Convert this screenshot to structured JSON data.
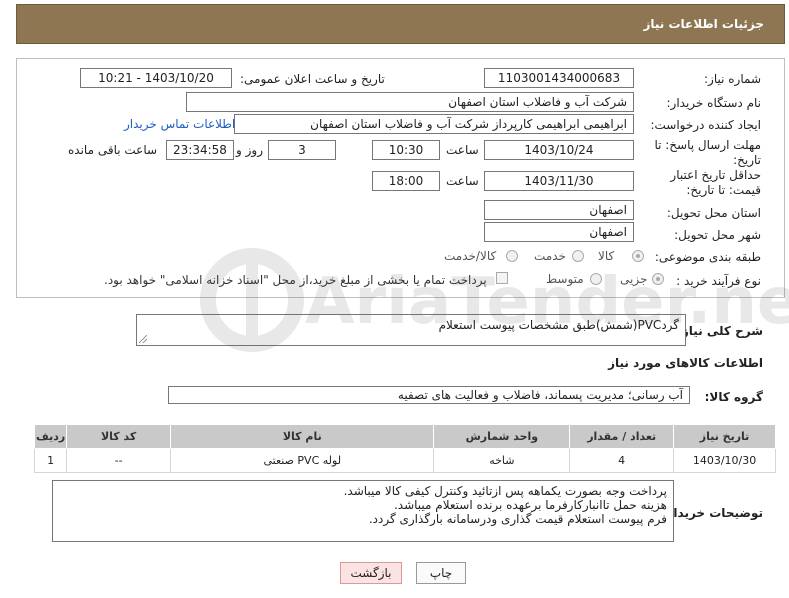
{
  "header": {
    "title": "جزئیات اطلاعات نیاز"
  },
  "form": {
    "need_number_label": "شماره نیاز:",
    "need_number": "1103001434000683",
    "announce_label": "تاریخ و ساعت اعلان عمومی:",
    "announce_value": "1403/10/20 - 10:21",
    "buyer_org_label": "نام دستگاه خریدار:",
    "buyer_org": "شرکت آب و فاضلاب استان اصفهان",
    "creator_label": "ایجاد کننده درخواست:",
    "creator": "ابراهیمی ابراهیمی کارپرداز شرکت آب و فاضلاب استان اصفهان",
    "contact_link": "اطلاعات تماس خریدار",
    "reply_deadline_label": "مهلت ارسال پاسخ: تا تاریخ:",
    "reply_date": "1403/10/24",
    "time_label": "ساعت",
    "reply_time": "10:30",
    "reply_days": "3",
    "days_label": "روز و",
    "remaining_time": "23:34:58",
    "remaining_label": "ساعت باقی مانده",
    "price_deadline_label": "حداقل تاریخ اعتبار قیمت: تا تاریخ:",
    "price_date": "1403/11/30",
    "price_time": "18:00",
    "province_label": "استان محل تحویل:",
    "province": "اصفهان",
    "city_label": "شهر محل تحویل:",
    "city": "اصفهان",
    "category_label": "طبقه بندی موضوعی:",
    "category_options": [
      "کالا",
      "خدمت",
      "کالا/خدمت"
    ],
    "purchase_type_label": "نوع فرآیند خرید :",
    "purchase_options": [
      "جزیی",
      "متوسط"
    ],
    "payment_note": "پرداخت تمام یا بخشی از مبلغ خرید،از محل \"اسناد خزانه اسلامی\" خواهد بود."
  },
  "general_desc": {
    "label": "شرح کلی نیاز:",
    "value": "گردPVC(شمش)طبق مشخصات پیوست استعلام"
  },
  "goods_info_title": "اطلاعات کالاهای مورد نیاز",
  "goods_group": {
    "label": "گروه کالا:",
    "value": "آب رسانی؛ مدیریت پسماند، فاضلاب و فعالیت های تصفیه"
  },
  "table": {
    "headers": [
      "ردیف",
      "کد کالا",
      "نام کالا",
      "واحد شمارش",
      "تعداد / مقدار",
      "تاریخ نیاز"
    ],
    "rows": [
      [
        "1",
        "--",
        "لوله PVC صنعتی",
        "شاخه",
        "4",
        "1403/10/30"
      ]
    ]
  },
  "buyer_notes": {
    "label": "توضیحات خریدار:",
    "lines": [
      "پرداخت وجه بصورت یکماهه پس ازتائید وکنترل کیفی کالا میباشد.",
      "هزینه حمل تاانبارکارفرما برعهده برنده استعلام میباشد.",
      "فرم پیوست استعلام قیمت گذاری ودرسامانه بارگذاری گردد."
    ]
  },
  "buttons": {
    "print": "چاپ",
    "back": "بازگشت"
  },
  "watermark": "AriaTender.neT",
  "colors": {
    "header_bg": "#8f7653",
    "link": "#1f5fbf",
    "table_header": "#c9c9c9"
  }
}
